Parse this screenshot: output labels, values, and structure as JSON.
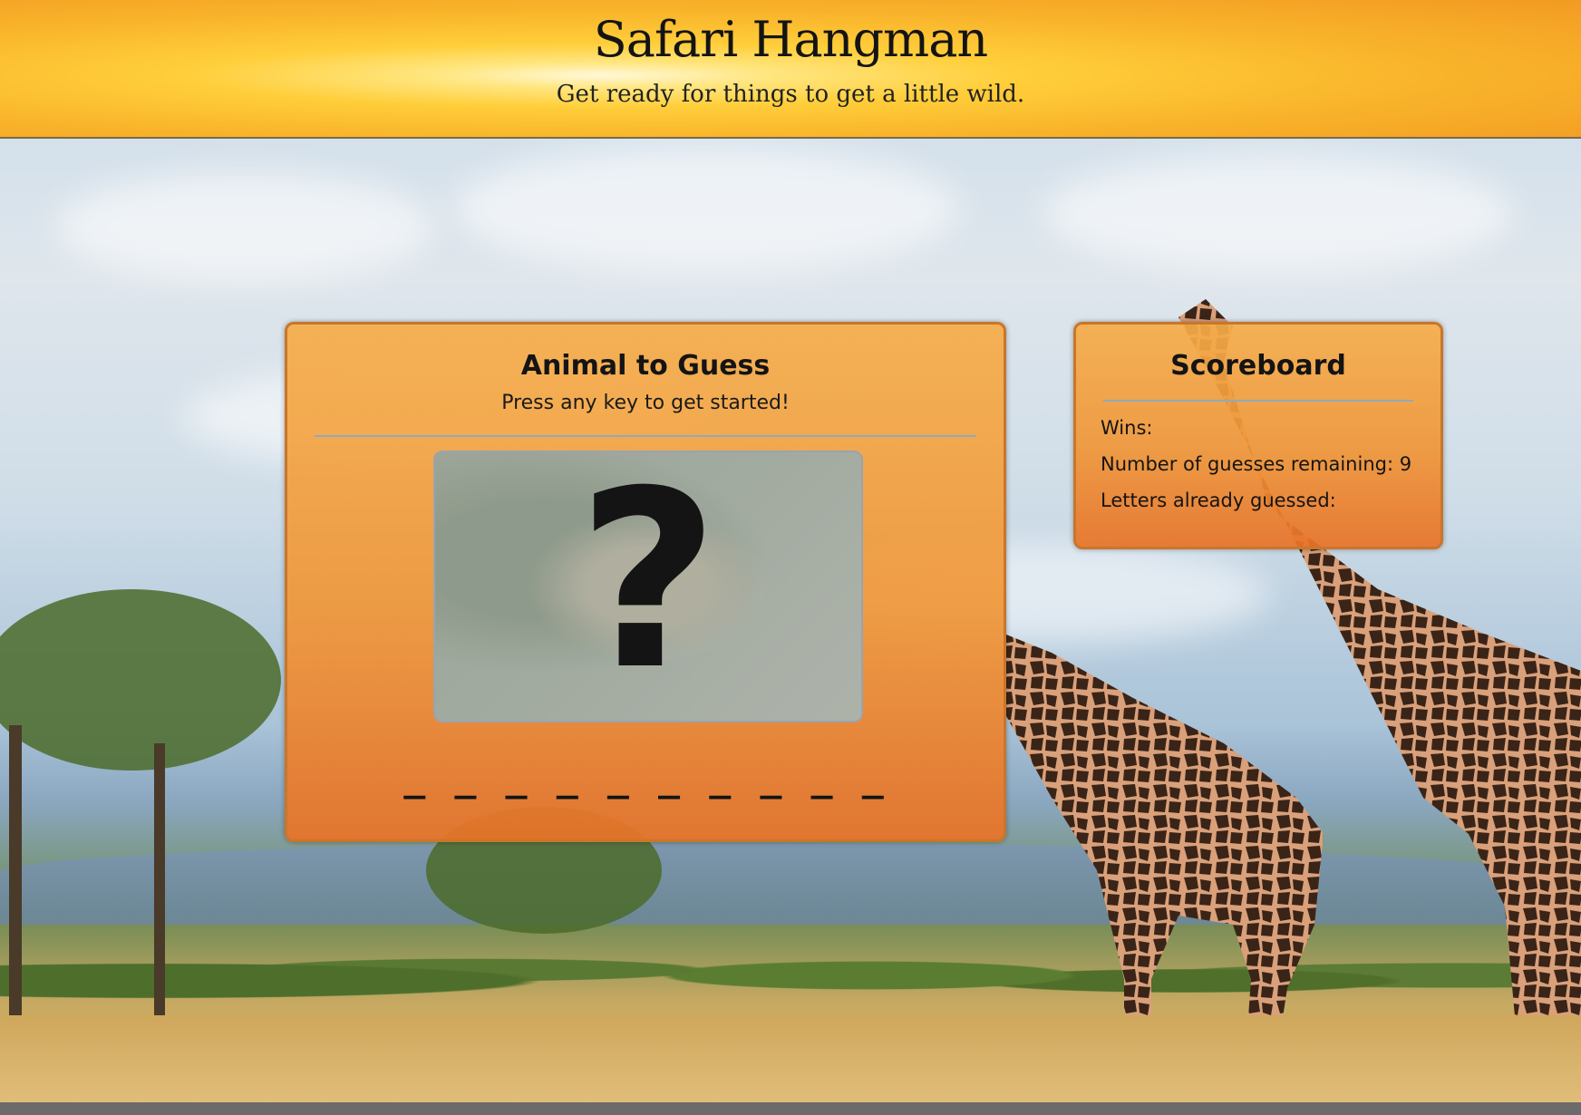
{
  "header": {
    "title": "Safari Hangman",
    "subtitle": "Get ready for things to get a little wild."
  },
  "game": {
    "title": "Animal to Guess",
    "prompt": "Press any key to get started!",
    "mystery_symbol": "?",
    "word_blanks": "_ _ _ _ _ _ _ _ _ _"
  },
  "scoreboard": {
    "title": "Scoreboard",
    "wins_label": "Wins:",
    "wins_value": "",
    "remaining_label": "Number of guesses remaining:",
    "remaining_value": "9",
    "letters_label": "Letters already guessed:",
    "letters_value": ""
  },
  "colors": {
    "panel_accent": "#f0962f",
    "header_sun": "#ffce3a"
  }
}
